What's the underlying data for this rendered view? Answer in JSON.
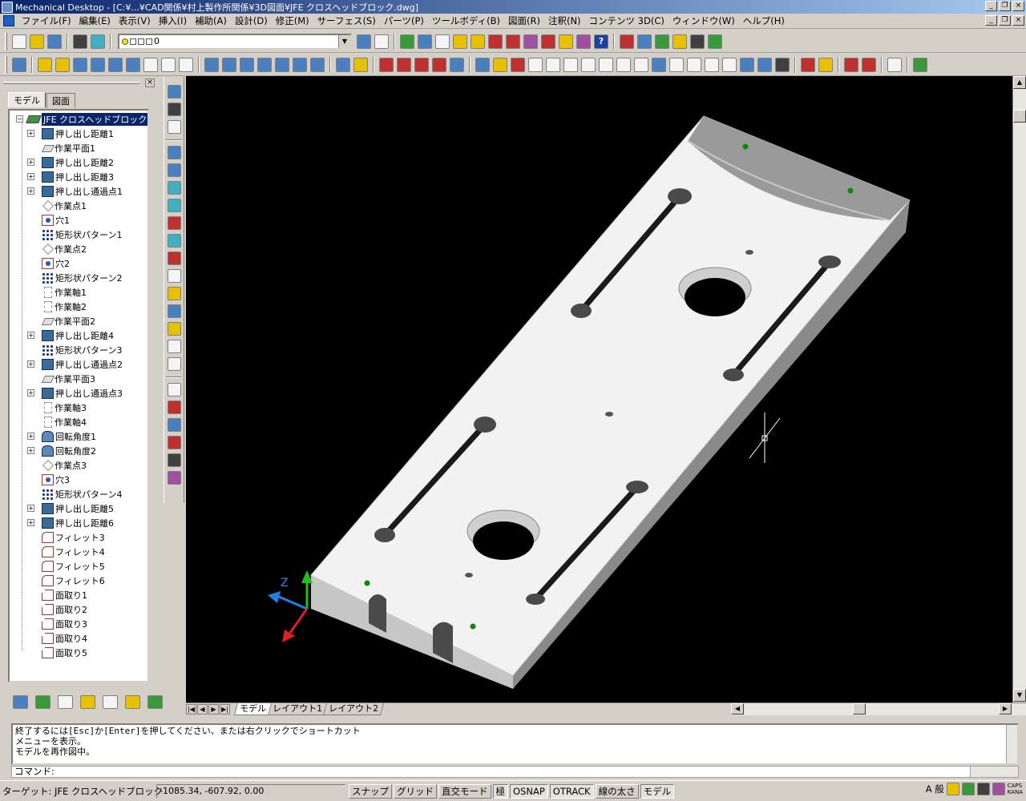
{
  "window": {
    "title": "Mechanical Desktop - [C:¥...¥CAD関係¥村上製作所関係¥3D図面¥JFE クロスヘッドブロック.dwg]",
    "minimize": "_",
    "restore": "❐",
    "close": "×"
  },
  "menubar": {
    "items": [
      "ファイル(F)",
      "編集(E)",
      "表示(V)",
      "挿入(I)",
      "補助(A)",
      "設計(D)",
      "修正(M)",
      "サーフェス(S)",
      "パーツ(P)",
      "ツールボディ(B)",
      "図面(R)",
      "注釈(N)",
      "コンテンツ 3D(C)",
      "ウィンドウ(W)",
      "ヘルプ(H)"
    ]
  },
  "toolbar1": {
    "layer_value": "0",
    "help_glyph": "?"
  },
  "browser": {
    "close_glyph": "×",
    "tabs": [
      "モデル",
      "図面"
    ],
    "root": "JFE クロスヘッドブロック",
    "items": [
      {
        "label": "押し出し距離1",
        "icon": "extrude-icon",
        "expandable": true
      },
      {
        "label": "作業平面1",
        "icon": "work-plane-icon",
        "expandable": false
      },
      {
        "label": "押し出し距離2",
        "icon": "extrude-icon",
        "expandable": true
      },
      {
        "label": "押し出し距離3",
        "icon": "extrude-icon",
        "expandable": true
      },
      {
        "label": "押し出し通過点1",
        "icon": "extrude-icon",
        "expandable": true
      },
      {
        "label": "作業点1",
        "icon": "work-point-icon",
        "expandable": false
      },
      {
        "label": "穴1",
        "icon": "hole-icon",
        "expandable": false
      },
      {
        "label": "矩形状パターン1",
        "icon": "pattern-icon",
        "expandable": false
      },
      {
        "label": "作業点2",
        "icon": "work-point-icon",
        "expandable": false
      },
      {
        "label": "穴2",
        "icon": "hole-icon",
        "expandable": false
      },
      {
        "label": "矩形状パターン2",
        "icon": "pattern-icon",
        "expandable": false
      },
      {
        "label": "作業軸1",
        "icon": "work-axis-icon",
        "expandable": false
      },
      {
        "label": "作業軸2",
        "icon": "work-axis-icon",
        "expandable": false
      },
      {
        "label": "作業平面2",
        "icon": "work-plane-icon",
        "expandable": false
      },
      {
        "label": "押し出し距離4",
        "icon": "extrude-icon",
        "expandable": true
      },
      {
        "label": "矩形状パターン3",
        "icon": "pattern-icon",
        "expandable": false
      },
      {
        "label": "押し出し通過点2",
        "icon": "extrude-icon",
        "expandable": true
      },
      {
        "label": "作業平面3",
        "icon": "work-plane-icon",
        "expandable": false
      },
      {
        "label": "押し出し通過点3",
        "icon": "extrude-icon",
        "expandable": true
      },
      {
        "label": "作業軸3",
        "icon": "work-axis-icon",
        "expandable": false
      },
      {
        "label": "作業軸4",
        "icon": "work-axis-icon",
        "expandable": false
      },
      {
        "label": "回転角度1",
        "icon": "revolve-icon",
        "expandable": true
      },
      {
        "label": "回転角度2",
        "icon": "revolve-icon",
        "expandable": true
      },
      {
        "label": "作業点3",
        "icon": "work-point-icon",
        "expandable": false
      },
      {
        "label": "穴3",
        "icon": "hole-icon",
        "expandable": false
      },
      {
        "label": "矩形状パターン4",
        "icon": "pattern-icon",
        "expandable": false
      },
      {
        "label": "押し出し距離5",
        "icon": "extrude-icon",
        "expandable": true
      },
      {
        "label": "押し出し距離6",
        "icon": "extrude-icon",
        "expandable": true
      },
      {
        "label": "フィレット3",
        "icon": "fillet-icon",
        "expandable": false
      },
      {
        "label": "フィレット4",
        "icon": "fillet-icon",
        "expandable": false
      },
      {
        "label": "フィレット5",
        "icon": "fillet-icon",
        "expandable": false
      },
      {
        "label": "フィレット6",
        "icon": "fillet-icon",
        "expandable": false
      },
      {
        "label": "面取り1",
        "icon": "chamfer-icon",
        "expandable": false
      },
      {
        "label": "面取り2",
        "icon": "chamfer-icon",
        "expandable": false
      },
      {
        "label": "面取り3",
        "icon": "chamfer-icon",
        "expandable": false
      },
      {
        "label": "面取り4",
        "icon": "chamfer-icon",
        "expandable": false
      },
      {
        "label": "面取り5",
        "icon": "chamfer-icon",
        "expandable": false
      }
    ]
  },
  "viewport": {
    "ucs_label": "Z",
    "background": "#000000",
    "part_color": "#f2f2f2"
  },
  "layout_tabs": {
    "nav": [
      "|◀",
      "◀",
      "▶",
      "▶|"
    ],
    "tabs": [
      "モデル",
      "レイアウト1",
      "レイアウト2"
    ]
  },
  "command": {
    "history": [
      "終了するには[Esc]か[Enter]を押してください、または右クリックでショートカット",
      "メニューを表示。",
      "モデルを再作図中。"
    ],
    "prompt": "コマンド:"
  },
  "status": {
    "target": "ターゲット: JFE クロスヘッドブロック",
    "coords": "-1085.34, -607.92, 0.00",
    "buttons": [
      {
        "label": "スナップ",
        "on": false
      },
      {
        "label": "グリッド",
        "on": false
      },
      {
        "label": "直交モード",
        "on": false
      },
      {
        "label": "極",
        "on": true
      },
      {
        "label": "OSNAP",
        "on": true
      },
      {
        "label": "OTRACK",
        "on": true
      },
      {
        "label": "線の太さ",
        "on": false
      },
      {
        "label": "モデル",
        "on": true
      }
    ],
    "ime": "A 般",
    "caps": "CAPS",
    "kana": "KANA"
  }
}
